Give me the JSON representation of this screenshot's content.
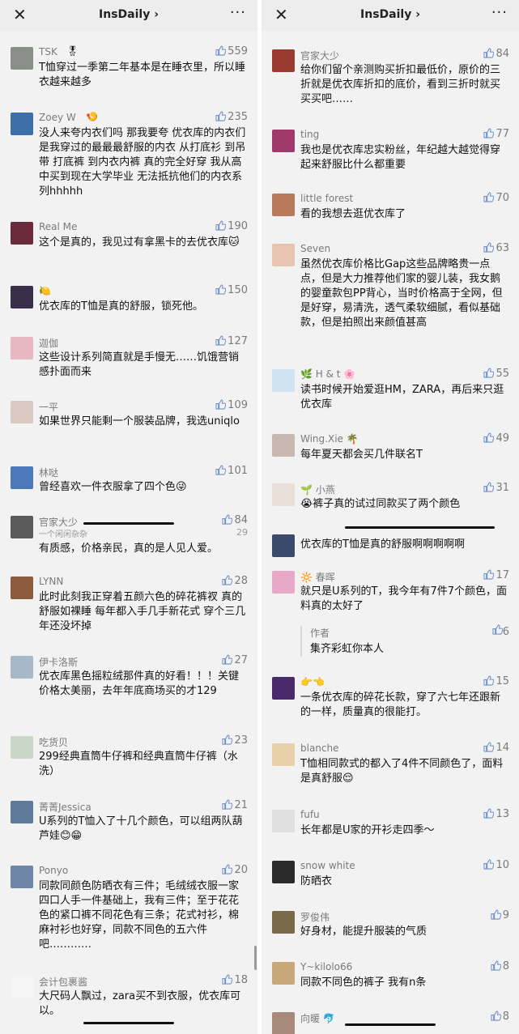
{
  "header": {
    "close_icon": "close-icon",
    "title": "InsDaily",
    "chevron": "›",
    "more": "···"
  },
  "left": {
    "comments": [
      {
        "name": "TSK",
        "badge": "🎖",
        "likes": "559",
        "text": "T恤穿过一季第二年基本是在睡衣里，所以睡衣越来越多",
        "avatar_color": "#8b8f8a"
      },
      {
        "name": "Zoey W",
        "badge": "🍤",
        "likes": "235",
        "text": "没人来夸内衣们吗 那我要夸 优衣库的内衣们是我穿过的最最最舒服的内衣 从打底衫 到吊带 打底裤 到内衣内裤 真的完全好穿 我从高中买到现在大学毕业 无法抵抗他们的内衣系列hhhhh",
        "avatar_color": "#3d6fa8"
      },
      {
        "name": "Real Me",
        "badge": "",
        "likes": "190",
        "text": "这个是真的，我见过有拿黑卡的去优衣库🐱",
        "avatar_color": "#6b2b3a"
      },
      {
        "name": "🍋",
        "badge": "",
        "likes": "150",
        "text": "优衣库的T恤是真的舒服，锁死他。",
        "avatar_color": "#3a2f4a"
      },
      {
        "name": "迦伽",
        "badge": "",
        "likes": "127",
        "text": "这些设计系列简直就是手慢无……饥饿营销感扑面而来",
        "avatar_color": "#e9b7c0"
      },
      {
        "name": "一平",
        "badge": "",
        "likes": "109",
        "text": "如果世界只能剩一个服装品牌，我选uniqlo",
        "avatar_color": "#d9c9c0"
      },
      {
        "name": "林哒",
        "badge": "",
        "likes": "101",
        "text": "曾经喜欢一件衣服拿了四个色😜",
        "avatar_color": "#4a78b8"
      },
      {
        "name": "官家大少",
        "badge": "",
        "likes": "84",
        "text": "有质感，价格亲民，真的是人见人爱。",
        "avatar_color": "#5a5a5a",
        "overlap_likes": "29",
        "overlap_name": "一个闲闲杂杂"
      },
      {
        "name": "LYNN",
        "badge": "",
        "likes": "28",
        "text": "此时此刻我正穿着五颜六色的碎花裤衩 真的舒服如裸睡 每年都入手几手新花式 穿个三几年还没坏掉",
        "avatar_color": "#8c5a3c"
      },
      {
        "name": "伊卡洛斯",
        "badge": "",
        "likes": "27",
        "text": "优衣库黑色摇粒绒那件真的好看！！！关键价格太美丽，去年年底商场买的才129",
        "avatar_color": "#a7b8c8"
      },
      {
        "name": "吃货贝",
        "badge": "",
        "likes": "23",
        "text": "299经典直筒牛仔裤和经典直筒牛仔裤（水洗）",
        "avatar_color": "#c9d7c8"
      },
      {
        "name": "菁菁Jessica",
        "badge": "",
        "likes": "21",
        "text": "U系列的T恤入了十几个颜色，可以组两队葫芦娃😊😁",
        "avatar_color": "#5d7a9a"
      },
      {
        "name": "Ponyo",
        "badge": "",
        "likes": "20",
        "text": "同款同颜色防晒衣有三件；毛绒绒衣服一家四口人手一件基础上，我有三件；至于花花色的紧口裤不同花色有三条；花式衬衫，棉麻衬衫也好穿，同款不同色的五六件吧…………",
        "avatar_color": "#6d86a8"
      },
      {
        "name": "会计包裹酱",
        "badge": "",
        "likes": "18",
        "text": "大尺码人飘过，zara买不到衣服，优衣库可以。",
        "avatar_color": "#f5f5f5"
      }
    ]
  },
  "right": {
    "comments": [
      {
        "name": "官家大少",
        "badge": "",
        "likes": "84",
        "text": "给你们留个亲测购买折扣最低价，原价的三折就是优衣库折扣的底价，看到三折时就买买买吧……",
        "avatar_color": "#9a3b32"
      },
      {
        "name": "ting",
        "badge": "",
        "likes": "77",
        "text": "我也是优衣库忠实粉丝，年纪越大越觉得穿起来舒服比什么都重要",
        "avatar_color": "#a03a6a"
      },
      {
        "name": "little forest",
        "badge": "",
        "likes": "70",
        "text": "看的我想去逛优衣库了",
        "avatar_color": "#b87a5a"
      },
      {
        "name": "Seven",
        "badge": "",
        "likes": "63",
        "text": "虽然优衣库价格比Gap这些品牌略贵一点点，但是大力推荐他们家的婴儿装，我女鹅的婴童款包PP背心，当时价格高于全网，但是好穿，易清洗，透气柔软细腻，看似基础款，但是拍照出来颜值甚高",
        "avatar_color": "#e8c3b0"
      },
      {
        "name": "🌿 H & t 🌸",
        "badge": "",
        "likes": "55",
        "text": "读书时候开始爱逛HM，ZARA，再后来只逛优衣库",
        "avatar_color": "#cfe3f0"
      },
      {
        "name": "Wing.Xie 🌴",
        "badge": "",
        "likes": "49",
        "text": "每年夏天都会买几件联名T",
        "avatar_color": "#c8b8b0"
      },
      {
        "name": "🌱 小燕",
        "badge": "",
        "likes": "31",
        "text": "😭裤子真的试过同款买了两个颜色",
        "avatar_color": "#e8e0d8"
      },
      {
        "name": "",
        "badge": "",
        "likes": "",
        "text": "优衣库的T恤是真的舒服啊啊啊啊啊",
        "avatar_color": "#3a4a6a"
      },
      {
        "name": "🔆 春晖",
        "badge": "",
        "likes": "17",
        "text": "就只是U系列的T，我今年有7件7个颜色，面料真的太好了",
        "avatar_color": "#e8a8c8",
        "reply": {
          "name": "作者",
          "likes": "6",
          "text": "集齐彩虹你本人"
        }
      },
      {
        "name": "👉👈",
        "badge": "",
        "likes": "15",
        "text": "一条优衣库的碎花长款，穿了六七年还跟新的一样，质量真的很能打。",
        "avatar_color": "#4a2a6a"
      },
      {
        "name": "blanche",
        "badge": "",
        "likes": "14",
        "text": "T恤相同款式的都入了4件不同颜色了，面料是真舒服😌",
        "avatar_color": "#e8d0a8"
      },
      {
        "name": "fufu",
        "badge": "",
        "likes": "13",
        "text": "长年都是U家的开衫走四季～",
        "avatar_color": "#e0e0e0"
      },
      {
        "name": "snow white",
        "badge": "",
        "likes": "10",
        "text": "防晒衣",
        "avatar_color": "#2a2a2a"
      },
      {
        "name": "罗俊伟",
        "badge": "",
        "likes": "9",
        "text": "好身材，能提升服装的气质",
        "avatar_color": "#7a6a4a"
      },
      {
        "name": "Y~kilolo66",
        "badge": "",
        "likes": "8",
        "text": "同款不同色的裤子 我有n条",
        "avatar_color": "#c8a878"
      },
      {
        "name": "向暖 🐬",
        "badge": "",
        "likes": "8",
        "text": "",
        "avatar_color": "#a88878"
      }
    ]
  }
}
